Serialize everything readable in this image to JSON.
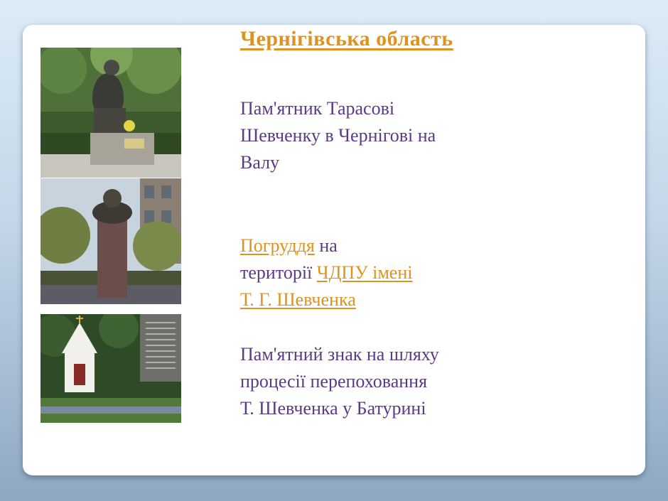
{
  "title": "Чернігівська  область",
  "caption1": {
    "line1": "Пам'ятник Тарасові",
    "line2": "Шевченку в Чернігові на",
    "line3": "Валу"
  },
  "caption2": {
    "link1": "Погруддя",
    "text1": " на",
    "text2": "території ",
    "link2": "ЧДПУ імені",
    "link3": "Т. Г. Шевченка"
  },
  "caption3": {
    "line1": "Пам'ятний знак на шляху",
    "line2": "процесії перепоховання",
    "line3": "Т. Шевченка у Батурині"
  },
  "colors": {
    "title": "#e0921f",
    "text": "#5b3a86",
    "link": "#e0921f"
  }
}
